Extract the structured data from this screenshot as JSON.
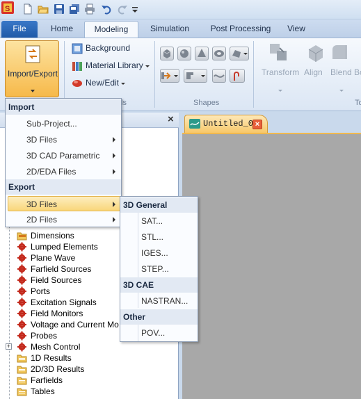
{
  "quick_access": {
    "icons": [
      "app-logo-icon",
      "new-file-icon",
      "open-folder-icon",
      "save-icon",
      "save-all-icon",
      "print-icon",
      "undo-icon",
      "redo-icon",
      "customize-arrow-icon"
    ]
  },
  "tabs": {
    "file": "File",
    "home": "Home",
    "modeling": "Modeling",
    "simulation": "Simulation",
    "post_processing": "Post Processing",
    "view": "View"
  },
  "ribbon": {
    "import_export": "Import/Export",
    "background": "Background",
    "material_library": "Material Library",
    "new_edit": "New/Edit",
    "materials_group_tail": "ls",
    "shapes_group": "Shapes",
    "transform": "Transform",
    "align": "Align",
    "blend": "Blend",
    "truncated_button": "Bo",
    "truncated_group": "To"
  },
  "nav_panel": {
    "close_glyph": "×",
    "tree_items": [
      {
        "label": "Dimensions",
        "icon": "folder-ruler-icon"
      },
      {
        "label": "Lumped Elements",
        "icon": "red-gear-icon"
      },
      {
        "label": "Plane Wave",
        "icon": "red-gear-icon"
      },
      {
        "label": "Farfield Sources",
        "icon": "red-gear-icon"
      },
      {
        "label": "Field Sources",
        "icon": "red-gear-icon"
      },
      {
        "label": "Ports",
        "icon": "red-gear-icon"
      },
      {
        "label": "Excitation Signals",
        "icon": "red-gear-icon"
      },
      {
        "label": "Field Monitors",
        "icon": "red-gear-icon"
      },
      {
        "label": "Voltage and Current Mo",
        "icon": "red-gear-icon"
      },
      {
        "label": "Probes",
        "icon": "red-gear-icon"
      },
      {
        "label": "Mesh Control",
        "icon": "red-gear-icon"
      },
      {
        "label": "1D Results",
        "icon": "folder-icon"
      },
      {
        "label": "2D/3D Results",
        "icon": "folder-icon"
      },
      {
        "label": "Farfields",
        "icon": "folder-icon"
      },
      {
        "label": "Tables",
        "icon": "folder-icon"
      }
    ]
  },
  "document": {
    "tab_title": "Untitled_0*"
  },
  "import_menu": {
    "import_header": "Import",
    "sub_project": "Sub-Project...",
    "import_3d": "3D Files",
    "cad_parametric": "3D CAD Parametric",
    "eda_files": "2D/EDA Files",
    "export_header": "Export",
    "export_3d": "3D Files",
    "export_2d": "2D Files"
  },
  "submenu": {
    "general_header": "3D General",
    "sat": "SAT...",
    "stl": "STL...",
    "iges": "IGES...",
    "step": "STEP...",
    "cae_header": "3D CAE",
    "nastran": "NASTRAN...",
    "other_header": "Other",
    "pov": "POV..."
  }
}
